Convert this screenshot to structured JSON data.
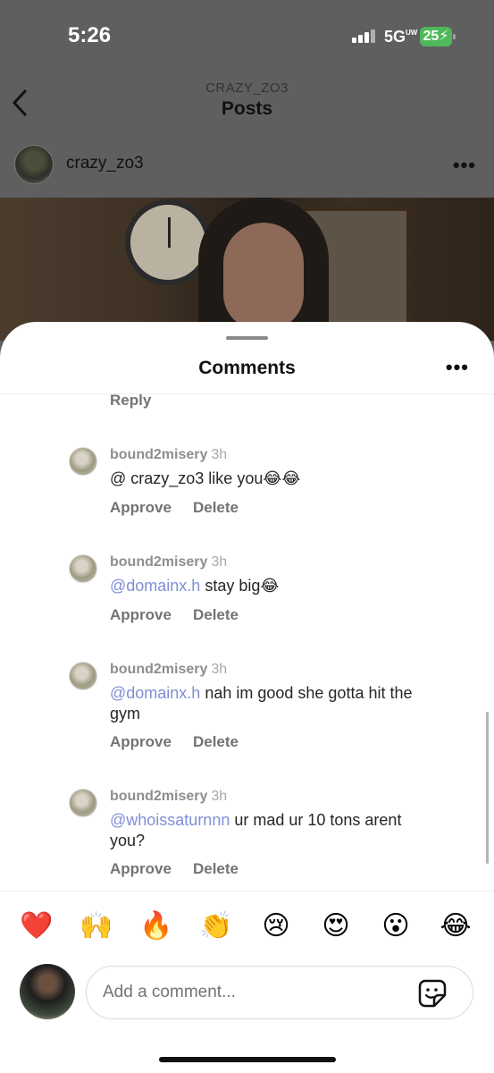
{
  "status_bar": {
    "time": "5:26",
    "network": "5G",
    "network_suffix": "UW",
    "battery": "25"
  },
  "nav": {
    "subtitle": "CRAZY_ZO3",
    "title": "Posts"
  },
  "post": {
    "username": "crazy_zo3",
    "more": "•••"
  },
  "sheet": {
    "title": "Comments",
    "more": "•••",
    "top_reply": "Reply",
    "comments": [
      {
        "user": "bound2misery",
        "time": "3h",
        "mention": "",
        "text": "@ crazy_zo3 like you😂😂",
        "approve": "Approve",
        "delete": "Delete"
      },
      {
        "user": "bound2misery",
        "time": "3h",
        "mention": "@domainx.h",
        "text": " stay big😂",
        "approve": "Approve",
        "delete": "Delete"
      },
      {
        "user": "bound2misery",
        "time": "3h",
        "mention": "@domainx.h",
        "text": " nah im good she gotta hit the gym",
        "approve": "Approve",
        "delete": "Delete"
      },
      {
        "user": "bound2misery",
        "time": "3h",
        "mention": "@whoissaturnnn",
        "text": " ur mad ur 10 tons arent you?",
        "approve": "Approve",
        "delete": "Delete"
      }
    ]
  },
  "emoji_bar": [
    "❤️",
    "🙌",
    "🔥",
    "👏",
    "😢",
    "😍",
    "😮",
    "😂"
  ],
  "composer": {
    "placeholder": "Add a comment..."
  },
  "colors": {
    "mention": "#7f8fd6",
    "battery": "#4fb85a",
    "action_text": "#737373"
  }
}
